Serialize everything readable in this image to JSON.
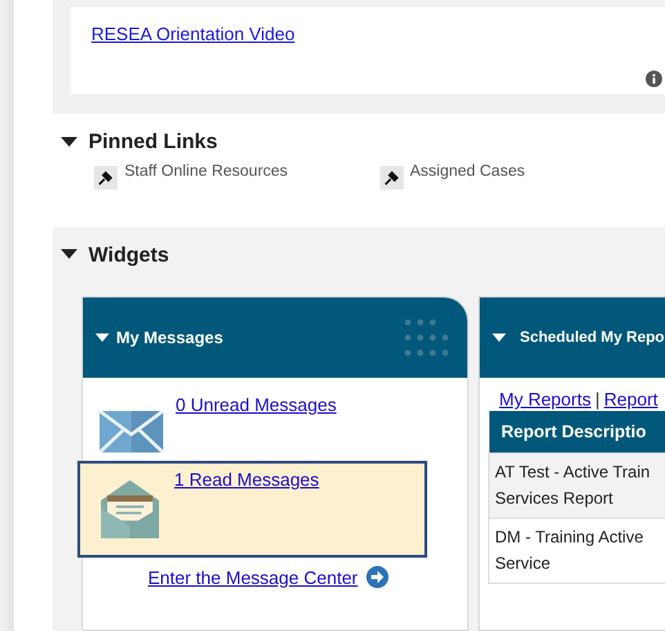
{
  "top_panel": {
    "link": "RESEA Orientation Video"
  },
  "pinned_links": {
    "title": "Pinned Links",
    "expanded": true,
    "items": [
      "Staff Online Resources",
      "Assigned Cases"
    ]
  },
  "widgets": {
    "title": "Widgets",
    "expanded": true,
    "my_messages": {
      "title": "My Messages",
      "expanded": true,
      "items": [
        {
          "kind": "unread",
          "label": "0 Unread Messages",
          "selected": false
        },
        {
          "kind": "read",
          "label": "1 Read Messages",
          "selected": true
        }
      ],
      "footer_link": "Enter the Message Center"
    },
    "scheduled": {
      "title": "Scheduled My Repo",
      "expanded": true,
      "links": [
        "My Reports",
        "Report"
      ],
      "separator": "|",
      "table": {
        "columns": [
          "Report Descriptio"
        ],
        "rows": [
          {
            "cells": [
              [
                "AT Test - Active Train",
                "Services Report"
              ]
            ]
          },
          {
            "cells": [
              [
                "DM - Training Active",
                "Service"
              ]
            ]
          }
        ]
      }
    }
  }
}
